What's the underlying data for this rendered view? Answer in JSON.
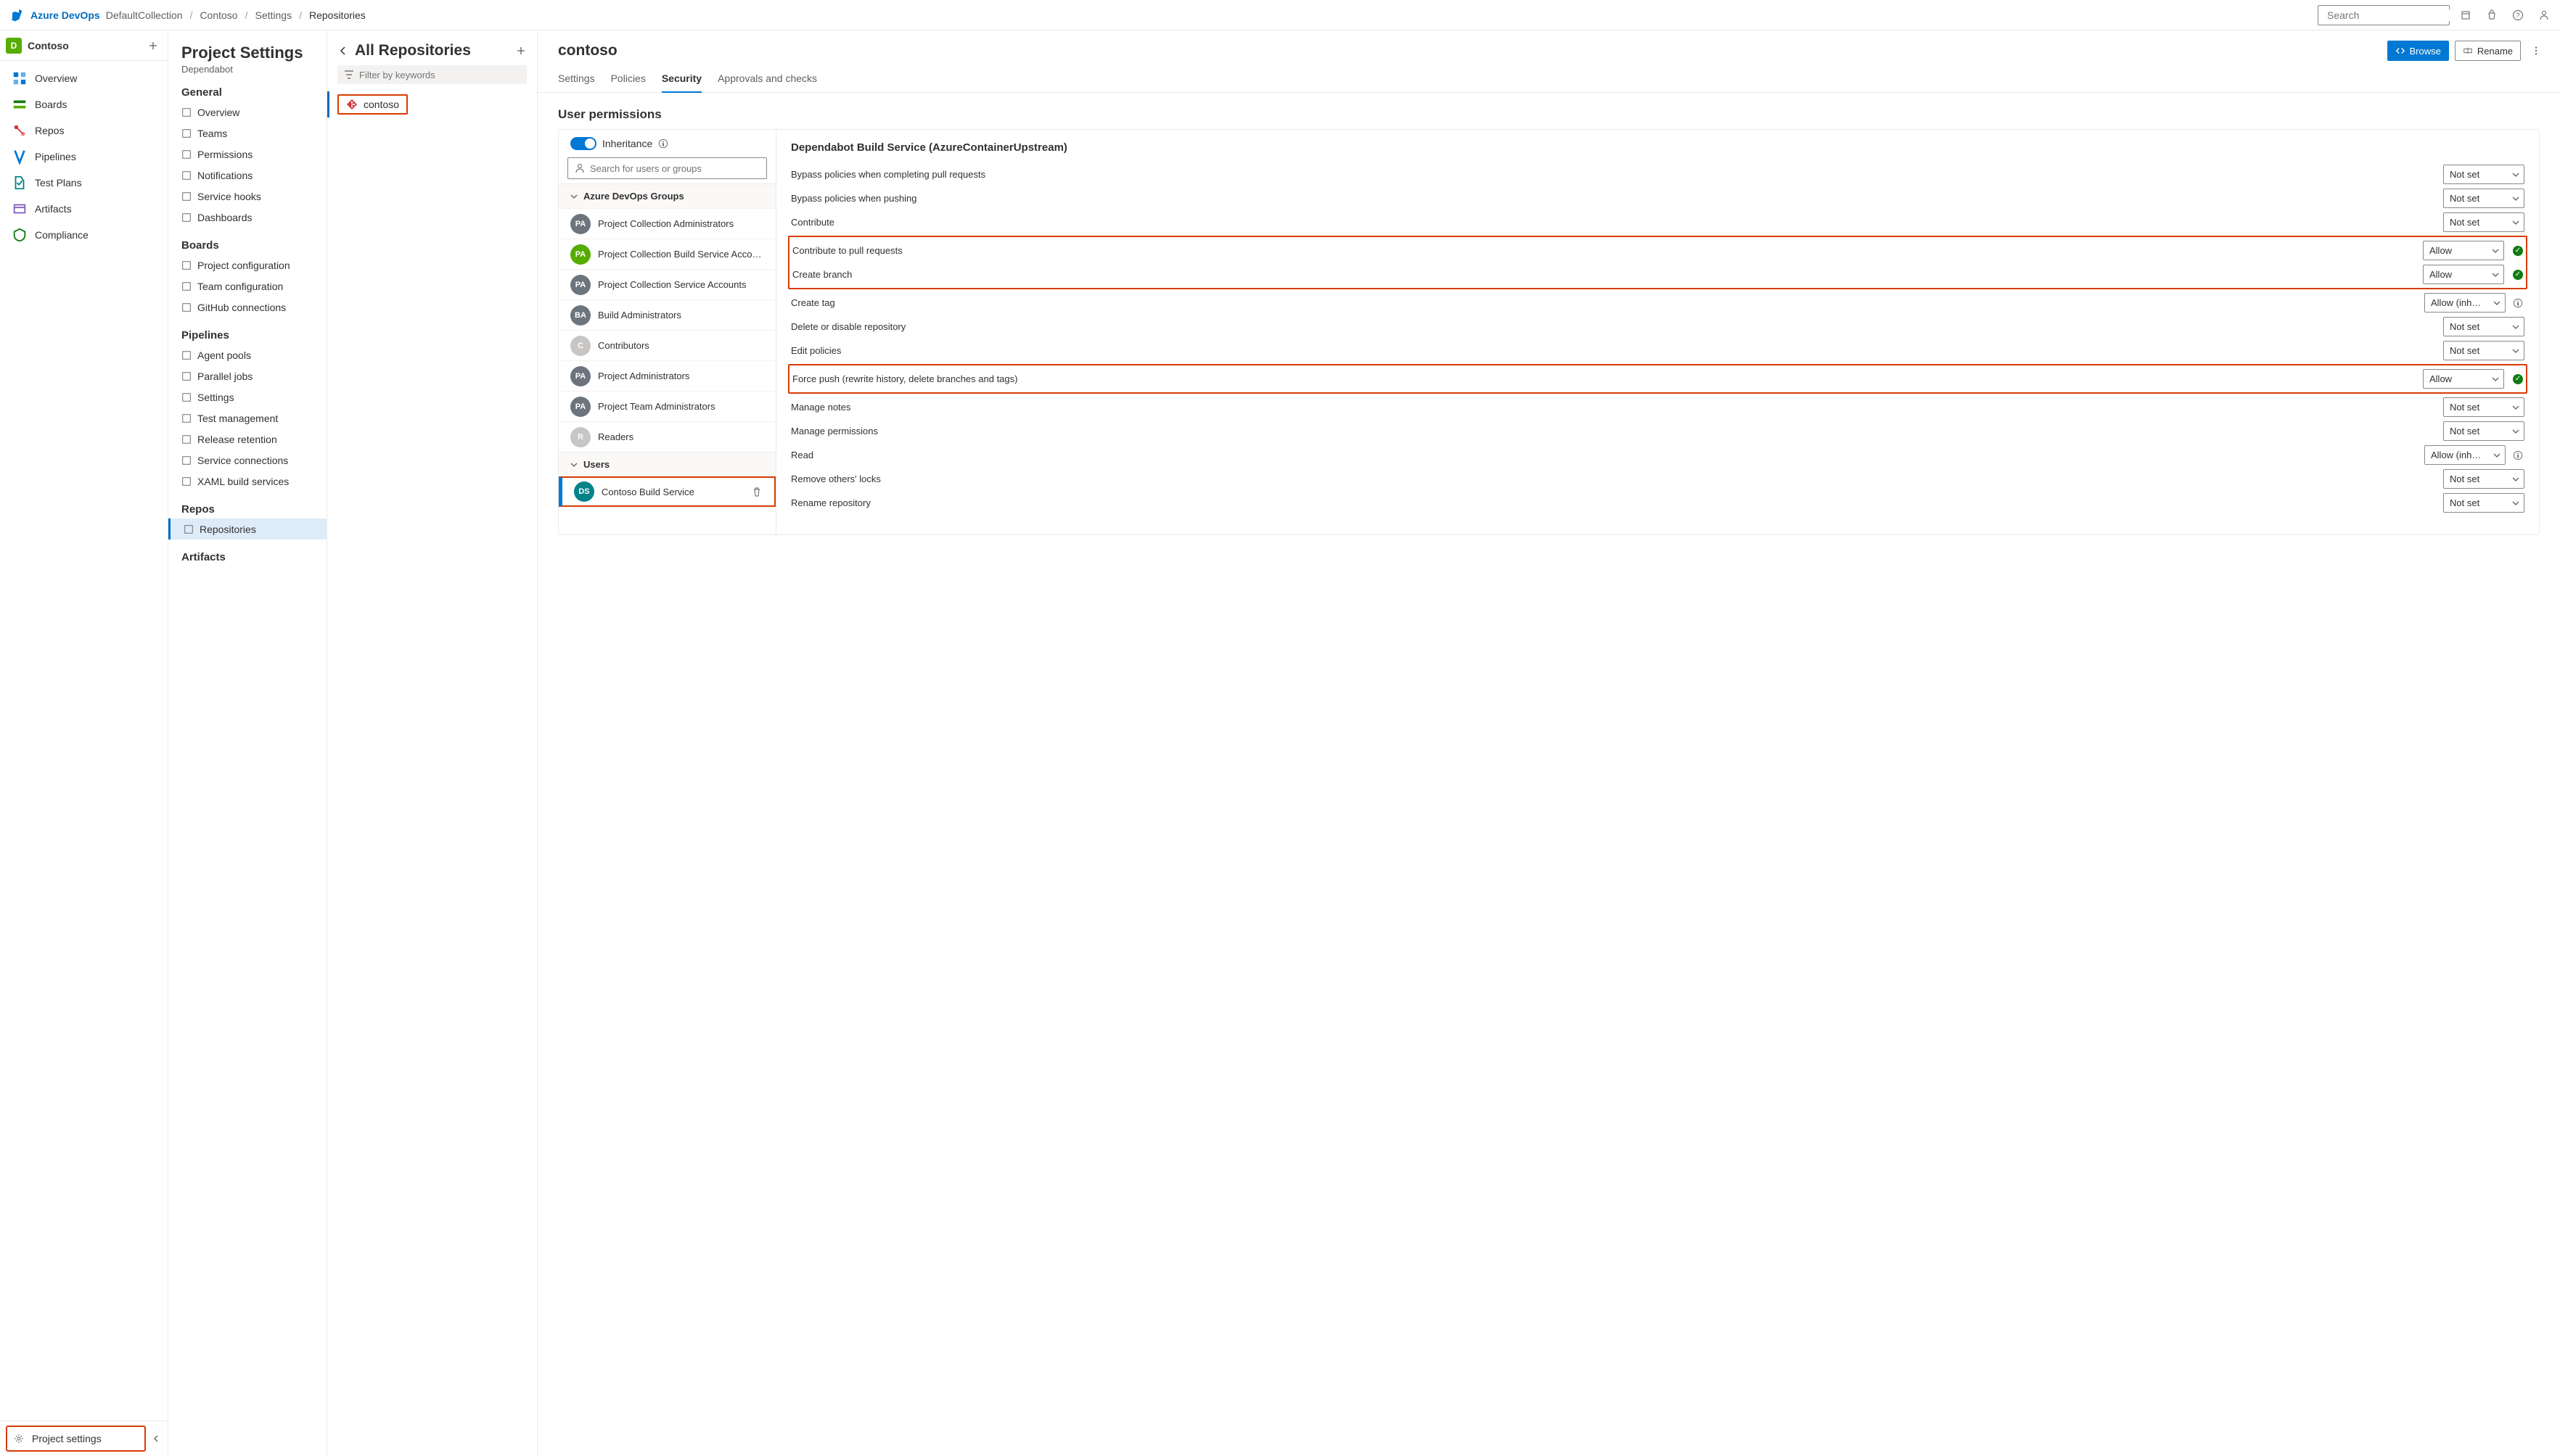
{
  "topbar": {
    "brand": "Azure DevOps",
    "breadcrumb": [
      "DefaultCollection",
      "Contoso",
      "Settings",
      "Repositories"
    ],
    "search_placeholder": "Search"
  },
  "leftnav": {
    "project_initial": "D",
    "project_name": "Contoso",
    "items": [
      {
        "label": "Overview"
      },
      {
        "label": "Boards"
      },
      {
        "label": "Repos"
      },
      {
        "label": "Pipelines"
      },
      {
        "label": "Test Plans"
      },
      {
        "label": "Artifacts"
      },
      {
        "label": "Compliance"
      }
    ],
    "footer": "Project settings"
  },
  "settings": {
    "title": "Project Settings",
    "subtitle": "Dependabot",
    "groups": [
      {
        "header": "General",
        "items": [
          "Overview",
          "Teams",
          "Permissions",
          "Notifications",
          "Service hooks",
          "Dashboards"
        ]
      },
      {
        "header": "Boards",
        "items": [
          "Project configuration",
          "Team configuration",
          "GitHub connections"
        ]
      },
      {
        "header": "Pipelines",
        "items": [
          "Agent pools",
          "Parallel jobs",
          "Settings",
          "Test management",
          "Release retention",
          "Service connections",
          "XAML build services"
        ]
      },
      {
        "header": "Repos",
        "items": [
          "Repositories"
        ]
      },
      {
        "header": "Artifacts",
        "items": []
      }
    ]
  },
  "repos": {
    "title": "All Repositories",
    "filter_placeholder": "Filter by keywords",
    "list": [
      "contoso"
    ]
  },
  "content": {
    "title": "contoso",
    "browse": "Browse",
    "rename": "Rename",
    "tabs": [
      "Settings",
      "Policies",
      "Security",
      "Approvals and checks"
    ],
    "active_tab": 2
  },
  "perm": {
    "header": "User permissions",
    "inheritance_label": "Inheritance",
    "user_search_placeholder": "Search for users or groups",
    "groups_label": "Azure DevOps Groups",
    "users_label": "Users",
    "groups": [
      {
        "initials": "PA",
        "color": "#6c757d",
        "name": "Project Collection Administrators"
      },
      {
        "initials": "PA",
        "color": "#56ac00",
        "name": "Project Collection Build Service Accounts"
      },
      {
        "initials": "PA",
        "color": "#6c757d",
        "name": "Project Collection Service Accounts"
      },
      {
        "initials": "BA",
        "color": "#6c757d",
        "name": "Build Administrators"
      },
      {
        "initials": "C",
        "color": "#c8c6c4",
        "name": "Contributors"
      },
      {
        "initials": "PA",
        "color": "#6c757d",
        "name": "Project Administrators"
      },
      {
        "initials": "PA",
        "color": "#6c757d",
        "name": "Project Team Administrators"
      },
      {
        "initials": "R",
        "color": "#c8c6c4",
        "name": "Readers"
      }
    ],
    "users": [
      {
        "initials": "DS",
        "color": "#038387",
        "name": "Contoso Build Service",
        "selected": true
      }
    ],
    "right_title": "Dependabot Build Service (AzureContainerUpstream)",
    "rows": [
      {
        "label": "Bypass policies when completing pull requests",
        "value": "Not set"
      },
      {
        "label": "Bypass policies when pushing",
        "value": "Not set"
      },
      {
        "label": "Contribute",
        "value": "Not set"
      },
      {
        "label": "Contribute to pull requests",
        "value": "Allow",
        "check": true,
        "hl": "start"
      },
      {
        "label": "Create branch",
        "value": "Allow",
        "check": true,
        "hl": "end"
      },
      {
        "label": "Create tag",
        "value": "Allow (inh…",
        "info": true
      },
      {
        "label": "Delete or disable repository",
        "value": "Not set"
      },
      {
        "label": "Edit policies",
        "value": "Not set"
      },
      {
        "label": "Force push (rewrite history, delete branches and tags)",
        "value": "Allow",
        "check": true,
        "hl": "single"
      },
      {
        "label": "Manage notes",
        "value": "Not set"
      },
      {
        "label": "Manage permissions",
        "value": "Not set"
      },
      {
        "label": "Read",
        "value": "Allow (inh…",
        "info": true
      },
      {
        "label": "Remove others' locks",
        "value": "Not set"
      },
      {
        "label": "Rename repository",
        "value": "Not set"
      }
    ]
  }
}
